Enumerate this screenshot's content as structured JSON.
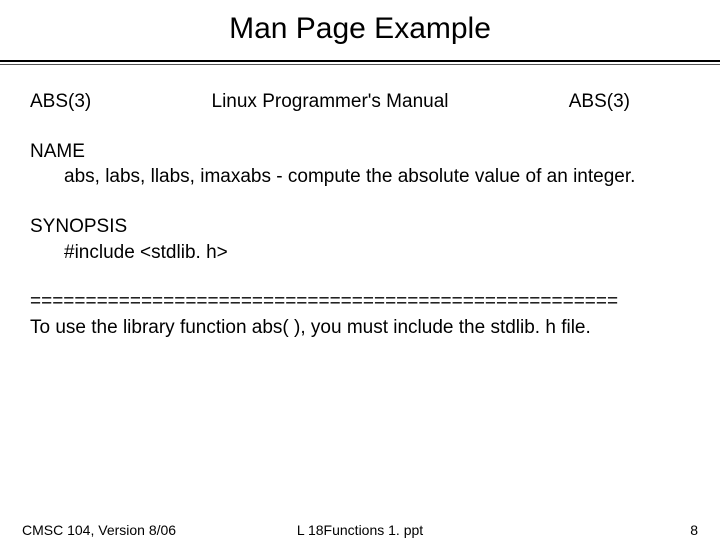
{
  "title": "Man Page Example",
  "man_header": {
    "left": "ABS(3)",
    "center": "Linux Programmer's Manual",
    "right": "ABS(3)"
  },
  "name_label": "NAME",
  "name_body": "abs, labs, llabs, imaxabs - compute the absolute value of an integer.",
  "synopsis_label": "SYNOPSIS",
  "synopsis_body": "#include <stdlib. h>",
  "separator": "=====================================================",
  "note": "To use the library function abs( ), you must include the stdlib. h file.",
  "footer": {
    "left": "CMSC 104, Version 8/06",
    "center": "L 18Functions 1. ppt",
    "right": "8"
  }
}
